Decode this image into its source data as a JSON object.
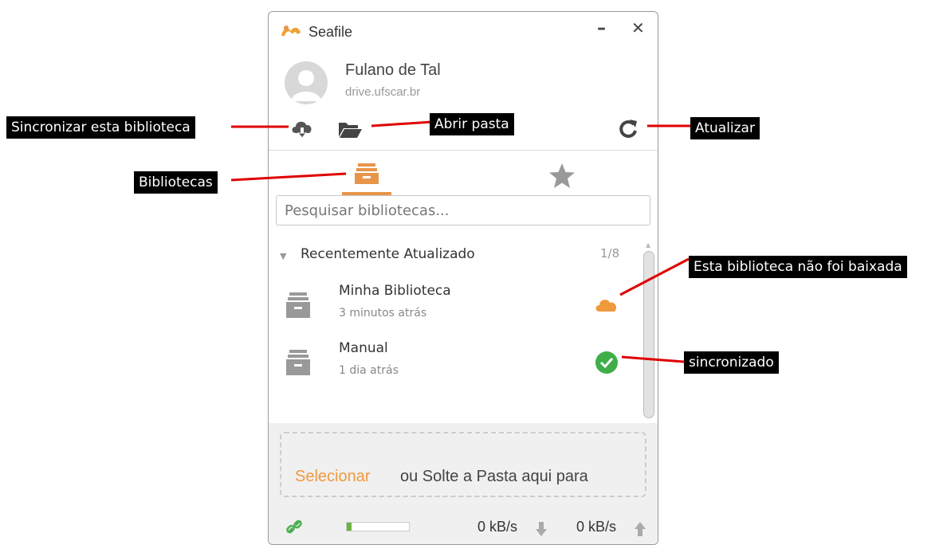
{
  "window": {
    "title": "Seafile",
    "minimize_label": "–",
    "close_label": "✕"
  },
  "account": {
    "name": "Fulano de Tal",
    "server": "drive.ufscar.br"
  },
  "toolbar": {
    "sync_icon": "cloud-download-icon",
    "open_icon": "folder-open-icon",
    "refresh_icon": "refresh-icon"
  },
  "tabs": [
    {
      "icon": "libraries-icon",
      "active": true
    },
    {
      "icon": "star-icon",
      "active": false
    }
  ],
  "search": {
    "placeholder": "Pesquisar bibliotecas..."
  },
  "group": {
    "title": "Recentemente Atualizado",
    "count": "1/8"
  },
  "libraries": [
    {
      "name": "Minha Biblioteca",
      "time": "3 minutos atrás",
      "status": "cloud-not-downloaded"
    },
    {
      "name": "Manual",
      "time": "1 dia atrás",
      "status": "synced"
    }
  ],
  "drop": {
    "select_label": "Selecionar",
    "text": "ou Solte a Pasta aqui para"
  },
  "status_bar": {
    "download_rate": "0 kB/s",
    "upload_rate": "0 kB/s",
    "progress": 0.08
  },
  "annotations": {
    "sync": "Sincronizar esta biblioteca",
    "open": "Abrir pasta",
    "refresh": "Atualizar",
    "libraries": "Bibliotecas",
    "not_downloaded": "Esta biblioteca não foi baixada",
    "synced": "sincronizado"
  },
  "colors": {
    "accent": "#e8954a",
    "synced": "#3fae49",
    "annotation_line": "#e00000"
  }
}
